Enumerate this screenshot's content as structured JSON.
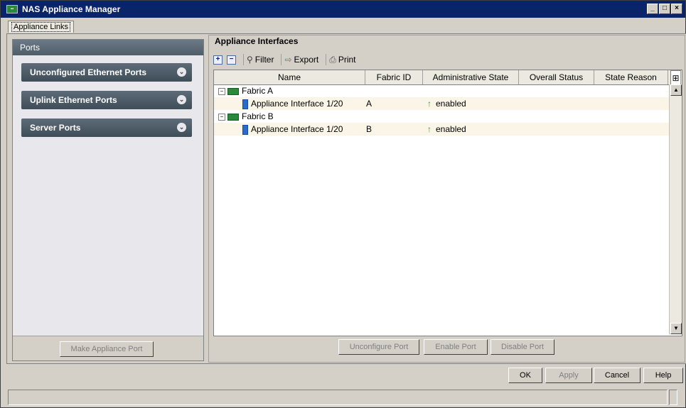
{
  "window": {
    "title": "NAS Appliance Manager"
  },
  "tabs": [
    {
      "label": "Appliance Links"
    }
  ],
  "left_panel": {
    "header": "Ports",
    "groups": [
      {
        "label": "Unconfigured Ethernet Ports"
      },
      {
        "label": "Uplink Ethernet Ports"
      },
      {
        "label": "Server Ports"
      }
    ],
    "make_button": "Make Appliance Port"
  },
  "right_panel": {
    "title": "Appliance Interfaces",
    "toolbar": {
      "filter": "Filter",
      "export": "Export",
      "print": "Print"
    },
    "columns": [
      "Name",
      "Fabric ID",
      "Administrative State",
      "Overall Status",
      "State Reason"
    ],
    "rows": [
      {
        "type": "group",
        "name": "Fabric A"
      },
      {
        "type": "item",
        "name": "Appliance Interface 1/20",
        "fabric": "A",
        "admin_state": "enabled"
      },
      {
        "type": "group",
        "name": "Fabric B"
      },
      {
        "type": "item",
        "name": "Appliance Interface 1/20",
        "fabric": "B",
        "admin_state": "enabled"
      }
    ],
    "buttons": {
      "unconfigure": "Unconfigure Port",
      "enable": "Enable Port",
      "disable": "Disable Port"
    }
  },
  "dialog_buttons": {
    "ok": "OK",
    "apply": "Apply",
    "cancel": "Cancel",
    "help": "Help"
  },
  "icons": [
    "app-icon",
    "expand-all-icon",
    "collapse-all-icon",
    "filter-icon",
    "export-icon",
    "print-icon",
    "column-chooser-icon",
    "fabric-icon",
    "interface-icon",
    "up-arrow-icon"
  ]
}
